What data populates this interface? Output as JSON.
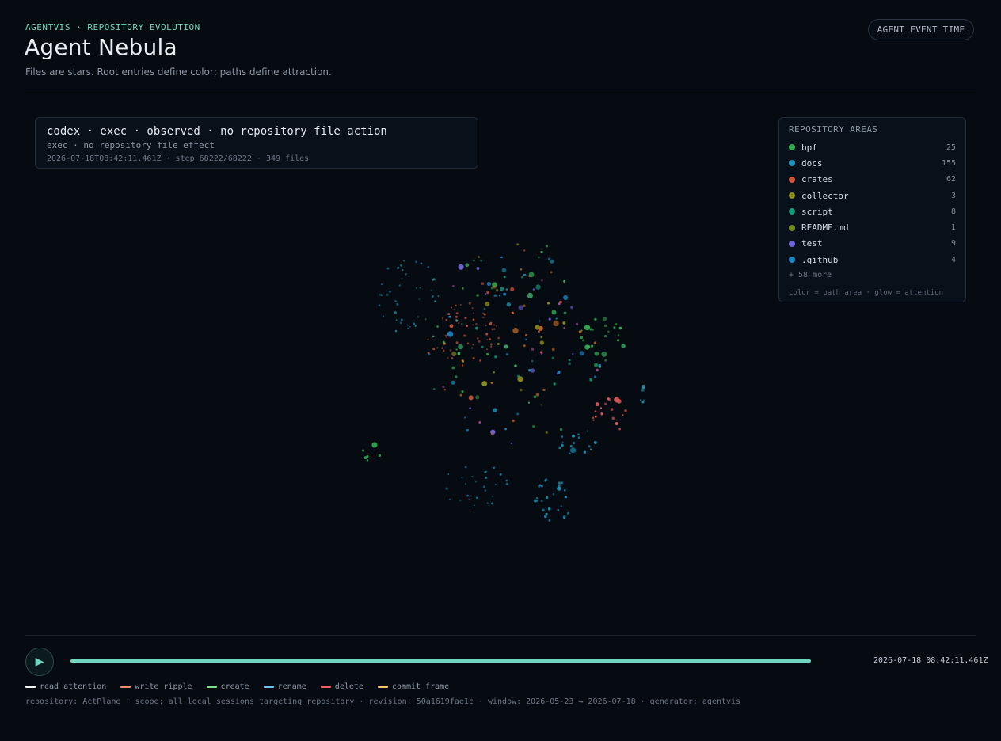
{
  "header": {
    "eyebrow": "AGENTVIS · REPOSITORY EVOLUTION",
    "title": "Agent Nebula",
    "subtitle": "Files are stars. Root entries define color; paths define attraction.",
    "time_mode_button": "AGENT EVENT TIME"
  },
  "event": {
    "title": "codex · exec · observed · no repository file action",
    "subtitle": "exec · no repository file effect",
    "meta": "2026-07-18T08:42:11.461Z · step 68222/68222 · 349 files"
  },
  "areas": {
    "heading": "REPOSITORY AREAS",
    "items": [
      {
        "name": "bpf",
        "count": "25",
        "color": "#2fa84f"
      },
      {
        "name": "docs",
        "count": "155",
        "color": "#1b93b8"
      },
      {
        "name": "crates",
        "count": "62",
        "color": "#d2563a"
      },
      {
        "name": "collector",
        "count": "3",
        "color": "#8b8a1c"
      },
      {
        "name": "script",
        "count": "8",
        "color": "#159a7c"
      },
      {
        "name": "README.md",
        "count": "1",
        "color": "#6f8a1f"
      },
      {
        "name": "test",
        "count": "9",
        "color": "#6d63d8"
      },
      {
        "name": ".github",
        "count": "4",
        "color": "#1989c9"
      }
    ],
    "more": "+ 58 more",
    "note": "color = path area · glow = attention"
  },
  "playback": {
    "progress": 1.0,
    "time": "2026-07-18 08:42:11.461Z"
  },
  "legend": [
    {
      "label": "read attention",
      "color": "#f2f5f8"
    },
    {
      "label": "write ripple",
      "color": "#f08a6a"
    },
    {
      "label": "create",
      "color": "#7ee08a"
    },
    {
      "label": "rename",
      "color": "#6cc6ea"
    },
    {
      "label": "delete",
      "color": "#ef5f6a"
    },
    {
      "label": "commit frame",
      "color": "#ecc86a"
    }
  ],
  "footer": "repository: ActPlane · scope: all local sessions targeting repository · revision: 50a1619fae1c · window: 2026-05-23 → 2026-07-18 · generator: agentvis"
}
